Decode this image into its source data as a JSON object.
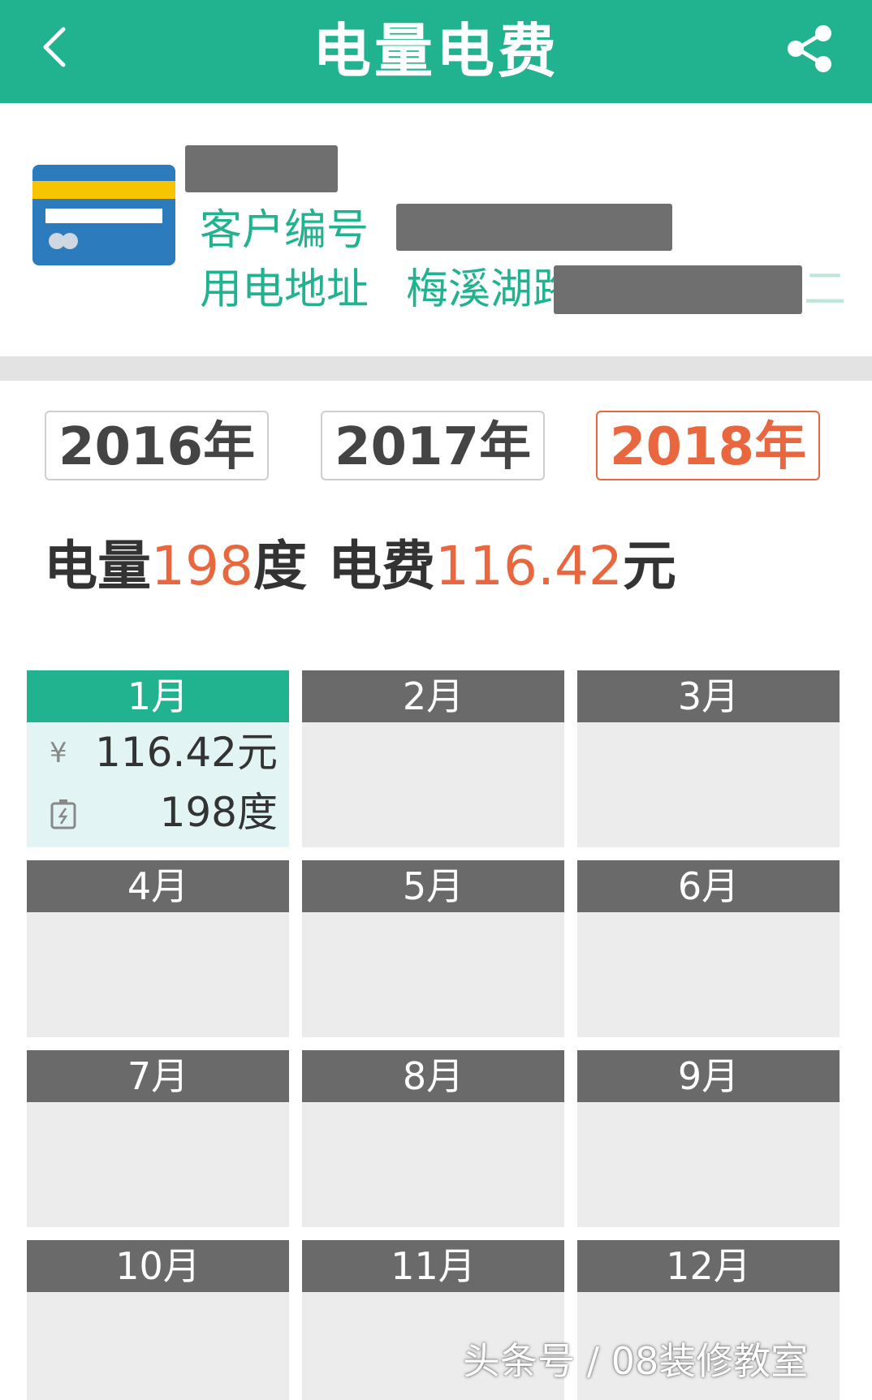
{
  "header": {
    "title": "电量电费",
    "back_icon": "chevron-left-icon",
    "share_icon": "share-icon"
  },
  "account": {
    "customer_no_label": "客户编号",
    "address_label": "用电地址",
    "address_visible": "梅溪湖路",
    "address_tail": "二",
    "card_colors": {
      "card": "#2b7bbd",
      "stripe": "#f6c500"
    }
  },
  "years": [
    "2016年",
    "2017年",
    "2018年"
  ],
  "selected_year": "2018年",
  "summary": {
    "usage_label": "电量",
    "usage_value": "198",
    "usage_unit": "度",
    "fee_label": "电费",
    "fee_value": "116.42",
    "fee_unit": "元"
  },
  "months": [
    {
      "label": "1月",
      "fee": "116.42元",
      "usage": "198度"
    },
    {
      "label": "2月"
    },
    {
      "label": "3月"
    },
    {
      "label": "4月"
    },
    {
      "label": "5月"
    },
    {
      "label": "6月"
    },
    {
      "label": "7月"
    },
    {
      "label": "8月"
    },
    {
      "label": "9月"
    },
    {
      "label": "10月"
    },
    {
      "label": "11月"
    },
    {
      "label": "12月"
    }
  ],
  "month_icons": {
    "fee": "yuan-icon",
    "usage": "battery-icon",
    "yuan_glyph": "¥"
  },
  "watermark": "头条号 / 08装修教室",
  "colors": {
    "accent": "#21b38f",
    "highlight": "#e8673f",
    "month_header": "#6a6a6a"
  }
}
